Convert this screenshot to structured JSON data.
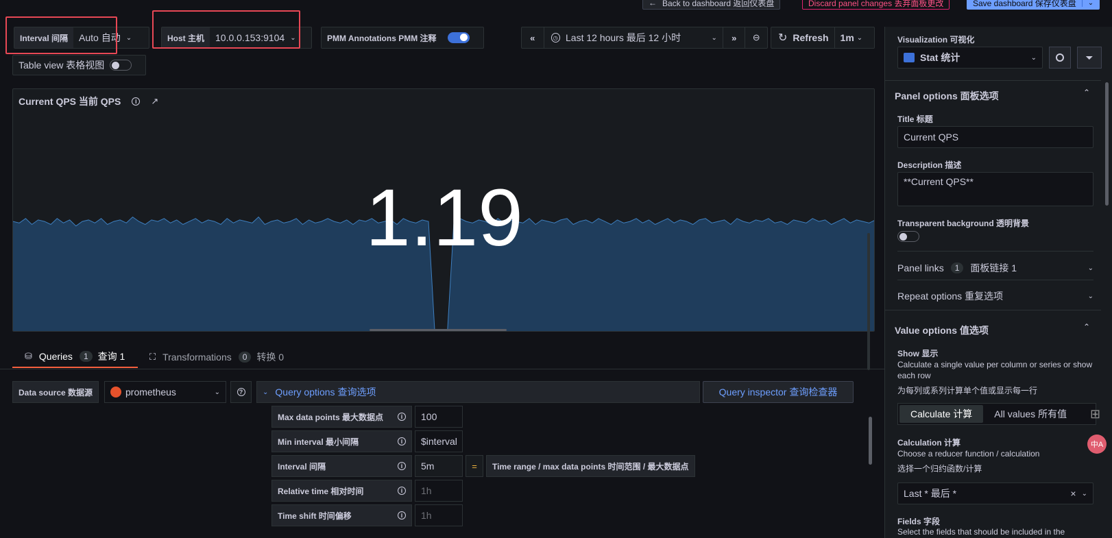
{
  "top_actions": {
    "back": "Back to dashboard  返回仪表盘",
    "discard": "Discard panel changes  丢弃面板更改",
    "save": "Save dashboard  保存仪表盘"
  },
  "variables": {
    "interval_label": "Interval  间隔",
    "interval_value": "Auto  自动",
    "host_label": "Host  主机",
    "host_value": "10.0.0.153:9104",
    "annotations_label": "PMM Annotations  PMM 注释",
    "table_view_label": "Table view  表格视图"
  },
  "time_controls": {
    "range": "Last 12 hours  最后 12 小时",
    "refresh": "Refresh",
    "refresh_interval": "1m"
  },
  "panel": {
    "title": "Current QPS  当前 QPS",
    "big_value": "1.19"
  },
  "sparkline": {
    "values": [
      0.74,
      0.73,
      0.76,
      0.72,
      0.75,
      0.74,
      0.72,
      0.76,
      0.73,
      0.75,
      0.71,
      0.74,
      0.75,
      0.73,
      0.76,
      0.72,
      0.74,
      0.75,
      0.73,
      0.77,
      0.74,
      0.72,
      0.75,
      0.74,
      0.76,
      0.73,
      0.75,
      0.72,
      0.74,
      0.76,
      0.73,
      0.75,
      0.74,
      0.72,
      0.76,
      0.73,
      0.75,
      0.74,
      0.73,
      0.77,
      0.72,
      0.74,
      0.75,
      0.73,
      0.74,
      0.76,
      0.72,
      0.75,
      0.73,
      0.74,
      0.76,
      0.74,
      0.73,
      0.75,
      0.72,
      0.75,
      0.74,
      0.76,
      0.73,
      0.74,
      0.75,
      0.72,
      0.76,
      0.74,
      0.73,
      0.75,
      0.74,
      0.0,
      0.0,
      0.0,
      0.72,
      0.76,
      0.74,
      0.73,
      0.75,
      0.74,
      0.72,
      0.76,
      0.73,
      0.75,
      0.74,
      0.73,
      0.76,
      0.72,
      0.75,
      0.74,
      0.73,
      0.75,
      0.76,
      0.72,
      0.74,
      0.75,
      0.73,
      0.76,
      0.74,
      0.72,
      0.75,
      0.73,
      0.74,
      0.76,
      0.73,
      0.75,
      0.72,
      0.74,
      0.76,
      0.73,
      0.75,
      0.74,
      0.72,
      0.75,
      0.76,
      0.73,
      0.74,
      0.75,
      0.72,
      0.76,
      0.74,
      0.73,
      0.75,
      0.74,
      0.76,
      0.73,
      0.74,
      0.72,
      0.75,
      0.74,
      0.73,
      0.76,
      0.74,
      0.75,
      0.72,
      0.74,
      0.76,
      0.73,
      0.75,
      0.74,
      0.73,
      0.75
    ]
  },
  "tabs": {
    "queries_label": "Queries",
    "queries_count": "1",
    "queries_cn": "查询 1",
    "transformations_label": "Transformations",
    "transformations_count": "0",
    "transformations_cn": "转换 0"
  },
  "query": {
    "datasource_label": "Data source  数据源",
    "datasource_value": "prometheus",
    "options_label": "Query options  查询选项",
    "inspector_label": "Query inspector  查询检查器",
    "rows": [
      {
        "label": "Max data points  最大数据点",
        "value": "100",
        "placeholder": false
      },
      {
        "label": "Min interval  最小间隔",
        "value": "$interval",
        "placeholder": false
      },
      {
        "label": "Interval  间隔",
        "value": "5m",
        "placeholder": false
      },
      {
        "label": "Relative time  相对时间",
        "value": "1h",
        "placeholder": true
      },
      {
        "label": "Time shift  时间偏移",
        "value": "1h",
        "placeholder": true
      }
    ],
    "equals": "=",
    "interval_formula": "Time range / max data points  时间范围 / 最大数据点"
  },
  "sidebar": {
    "visualization_label": "Visualization  可视化",
    "visualization_value": "Stat  统计",
    "panel_options": "Panel options  面板选项",
    "title_label": "Title  标题",
    "title_value": "Current QPS",
    "description_label": "Description  描述",
    "description_value": "**Current QPS**",
    "transparent_label": "Transparent background  透明背景",
    "panel_links_label": "Panel links",
    "panel_links_count": "1",
    "panel_links_cn": "面板链接 1",
    "repeat_options": "Repeat options  重复选项",
    "value_options": "Value options  值选项",
    "show_label": "Show  显示",
    "show_desc": "Calculate a single value per column or series or show each row",
    "show_desc_cn": "为每列或系列计算单个值或显示每一行",
    "calculate": "Calculate  计算",
    "all_values": "All values  所有值",
    "calculation_label": "Calculation  计算",
    "calculation_desc": "Choose a reducer function / calculation",
    "calculation_desc_cn": "选择一个归约函数/计算",
    "calculation_value": "Last *  最后 *",
    "fields_label": "Fields  字段",
    "fields_desc": "Select the fields that should be included in the"
  }
}
